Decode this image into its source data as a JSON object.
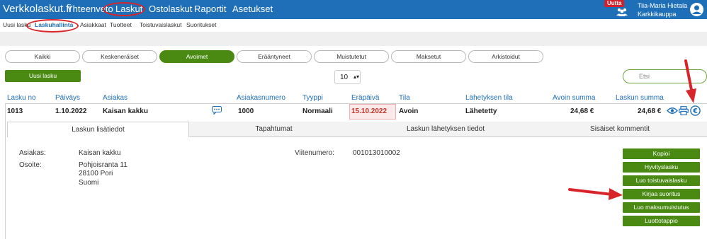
{
  "header": {
    "brand": "Verkkolaskut.fi",
    "nav": [
      "Yhteenveto",
      "Laskut",
      "Ostolaskut",
      "Raportit",
      "Asetukset"
    ],
    "new_badge": "Uutta",
    "user_name": "Tiia-Maria Hietala",
    "company": "Karkkikauppa"
  },
  "subnav": [
    "Uusi lasku",
    "Laskuhallinta",
    "Asiakkaat",
    "Tuotteet",
    "Toistuvaislaskut",
    "Suoritukset"
  ],
  "filters": [
    "Kaikki",
    "Keskeneräiset",
    "Avoimet",
    "Erääntyneet",
    "Muistutetut",
    "Maksetut",
    "Arkistoidut"
  ],
  "toolbar": {
    "new_invoice": "Uusi lasku",
    "page_size": "10",
    "search_placeholder": "Etsi"
  },
  "table": {
    "headers": [
      "Lasku no",
      "Päiväys",
      "Asiakas",
      "Asiakasnumero",
      "Tyyppi",
      "Eräpäivä",
      "Tila",
      "Lähetyksen tila",
      "Avoin summa",
      "Laskun summa"
    ],
    "row": {
      "invoice_no": "1013",
      "date": "1.10.2022",
      "customer": "Kaisan kakku",
      "customer_no": "1000",
      "type": "Normaali",
      "due_date": "15.10.2022",
      "status": "Avoin",
      "send_status": "Lähetetty",
      "open_amount": "24,68 €",
      "total_amount": "24,68 €"
    }
  },
  "tabs": [
    "Laskun lisätiedot",
    "Tapahtumat",
    "Laskun lähetyksen tiedot",
    "Sisäiset kommentit"
  ],
  "details": {
    "customer_label": "Asiakas:",
    "customer_value": "Kaisan kakku",
    "address_label": "Osoite:",
    "address_lines": [
      "Pohjoisranta 11",
      "28100 Pori",
      "Suomi"
    ],
    "reference_label": "Viitenumero:",
    "reference_value": "001013010002"
  },
  "actions": [
    "Kopioi",
    "Hyvityslasku",
    "Luo toistuvaislasku",
    "Kirjaa suoritus",
    "Luo maksumuistutus",
    "Luottotappio"
  ],
  "colors": {
    "nav_blue": "#1e6fb7",
    "green": "#4a8a13",
    "annotation_red": "#d9252a"
  },
  "icons": [
    "users-icon",
    "user-avatar-icon",
    "comment-icon",
    "view-eye-icon",
    "print-icon",
    "euro-payment-icon"
  ]
}
